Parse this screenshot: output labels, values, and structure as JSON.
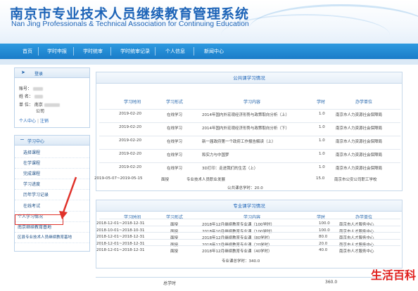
{
  "header": {
    "title": "南京市专业技术人员继续教育管理系统",
    "subtitle": "Nan Jing Professionals & Technical Association for Continuing Education"
  },
  "nav": {
    "items": [
      "首页",
      "学时申报",
      "学时统审",
      "学时统审记录",
      "个人信息",
      "新闻中心"
    ]
  },
  "login_panel": {
    "title": "登录",
    "account_label": "账号：",
    "name_label": "姓 名：",
    "unit_label": "单 位：",
    "unit_value_line1": "南京",
    "unit_value_line2": "公司",
    "personal_center": "个人中心",
    "logout": "注销"
  },
  "menu_panel": {
    "title": "学习中心",
    "items": [
      "选择课程",
      "在学课程",
      "完成课程",
      "学习进度",
      "历年学习记录",
      "在线考试",
      "个人学习情况",
      "南京继续教育基地",
      "区县专业技术人员继续教育基地"
    ]
  },
  "public_box": {
    "title": "公共课学习情况",
    "headers": [
      "学习时间",
      "学习形式",
      "学习内容",
      "学时",
      "办学单位"
    ],
    "rows": [
      [
        "2019-02-20",
        "在线学习",
        "2014年国内外宏观经济形势与政策取向分析（上）",
        "1.0",
        "南京市人力资源社会保障局"
      ],
      [
        "2019-02-20",
        "在线学习",
        "2014年国内外宏观经济形势与政策取向分析（下）",
        "1.0",
        "南京市人力资源社会保障局"
      ],
      [
        "2019-02-20",
        "在线学习",
        "新一届政府第一个政府工作报告解读（上）",
        "1.0",
        "南京市人力资源社会保障局"
      ],
      [
        "2019-02-20",
        "在线学习",
        "和实力与中国梦",
        "1.0",
        "南京市人力资源社会保障局"
      ],
      [
        "2019-02-20",
        "在线学习",
        "3D打印：走进我们的生活（上）",
        "1.0",
        "南京市人力资源社会保障局"
      ]
    ],
    "extra_row": [
      "2019-05-07~2019-05-15",
      "面授",
      "专业技术人员职业发展",
      "15.0",
      "南京市公安公司职工学校"
    ],
    "total": "公共课总学时：20.0"
  },
  "pro_box": {
    "title": "专业课学习情况",
    "headers": [
      "学习时间",
      "学习形式",
      "学习内容",
      "学时",
      "办学单位"
    ],
    "rows": [
      [
        "2018-12-01~2018-12-31",
        "面授",
        "2018年12月继续教育专业课（100学时）",
        "100.0",
        "南京市人才服务中心"
      ],
      [
        "2018-10-01~2018-10-31",
        "面授",
        "2018年10月继续教育专业课（100学时）",
        "100.0",
        "南京市人才服务中心"
      ],
      [
        "2018-12-01~2018-12-31",
        "面授",
        "2018年12月继续教育专业课（80学时）",
        "80.0",
        "南京市人才服务中心"
      ],
      [
        "2018-12-01~2018-12-31",
        "面授",
        "2018年12月继续教育专业课（20学时）",
        "20.0",
        "南京市人才服务中心"
      ],
      [
        "2018-12-01~2018-12-31",
        "面授",
        "2018年12月继续教育专业课（40学时）",
        "40.0",
        "南京市人才服务中心"
      ]
    ],
    "total": "专业课总学时：340.0"
  },
  "summary": {
    "label": "总学时",
    "value": "360.0"
  },
  "watermark": "生活百科",
  "colors": {
    "brand_blue": "#1c63b7",
    "nav_blue": "#1a7cc8",
    "highlight_red": "#e0322a"
  }
}
